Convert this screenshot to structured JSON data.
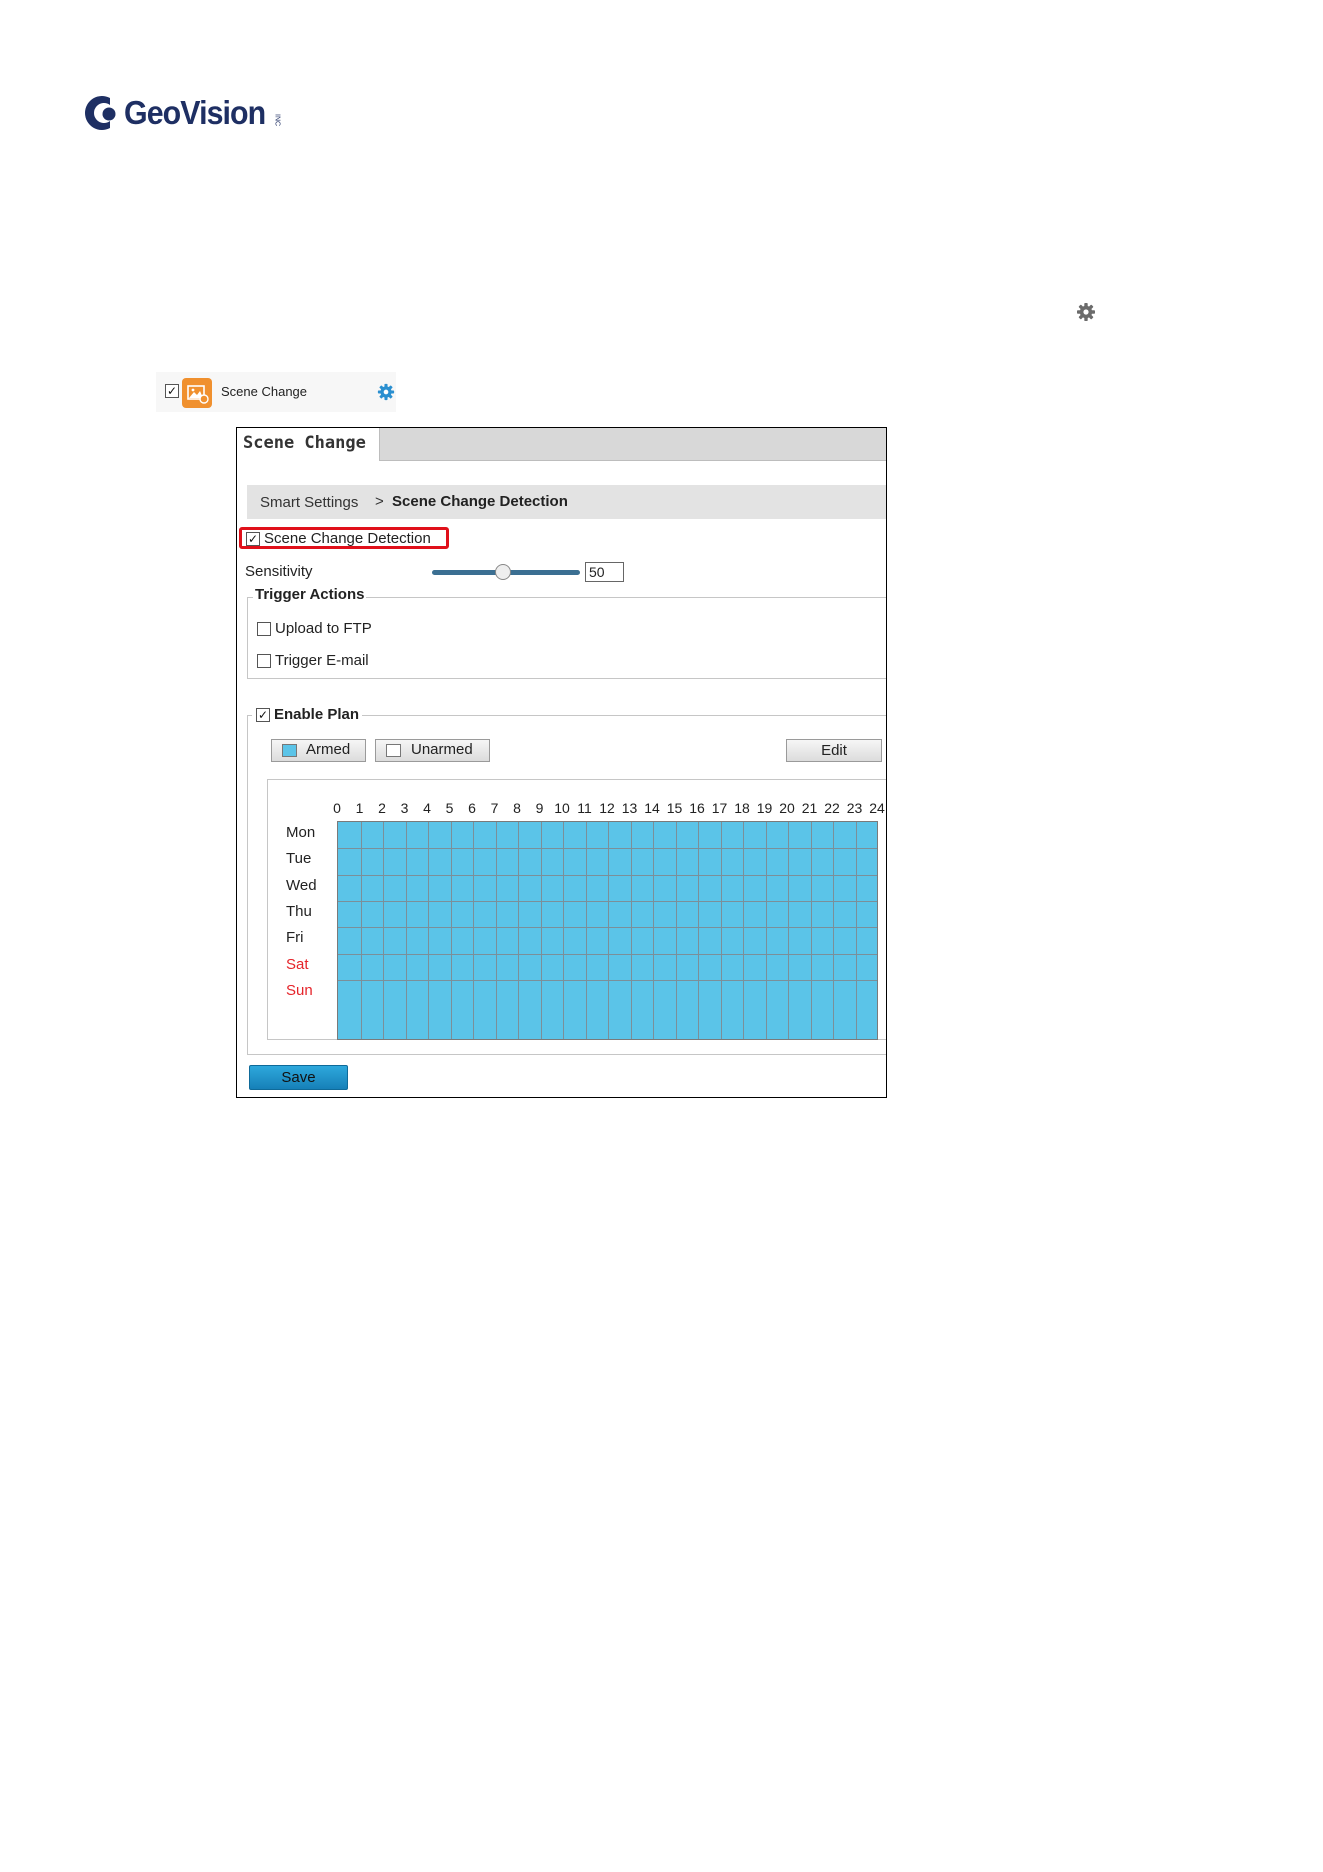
{
  "logo": {
    "brand": "GeoVision",
    "tm": "INC"
  },
  "feature_row": {
    "checked": true,
    "label": "Scene Change"
  },
  "panel": {
    "tab": "Scene Change",
    "breadcrumb": {
      "parent": "Smart Settings",
      "separator": ">",
      "current": "Scene Change Detection"
    },
    "detection": {
      "label": "Scene Change Detection",
      "checked": true
    },
    "sensitivity": {
      "label": "Sensitivity",
      "value": "50",
      "level": 50
    },
    "trigger_actions": {
      "title": "Trigger Actions",
      "items": [
        {
          "label": "Upload to FTP",
          "checked": false
        },
        {
          "label": "Trigger E-mail",
          "checked": false
        }
      ]
    },
    "plan": {
      "label": "Enable Plan",
      "checked": true,
      "legend": {
        "armed": "Armed",
        "unarmed": "Unarmed",
        "armed_color": "#5bc4e8",
        "unarmed_color": "#ffffff"
      },
      "edit_label": "Edit",
      "hours": [
        "0",
        "1",
        "2",
        "3",
        "4",
        "5",
        "6",
        "7",
        "8",
        "9",
        "10",
        "11",
        "12",
        "13",
        "14",
        "15",
        "16",
        "17",
        "18",
        "19",
        "20",
        "21",
        "22",
        "23",
        "24"
      ],
      "days": [
        "Mon",
        "Tue",
        "Wed",
        "Thu",
        "Fri",
        "Sat",
        "Sun"
      ],
      "weekend_color": "#e5242a"
    },
    "save_label": "Save"
  },
  "colors": {
    "accent": "#1e8fc8",
    "highlight": "#e0101a",
    "icon_orange": "#f0902e"
  }
}
